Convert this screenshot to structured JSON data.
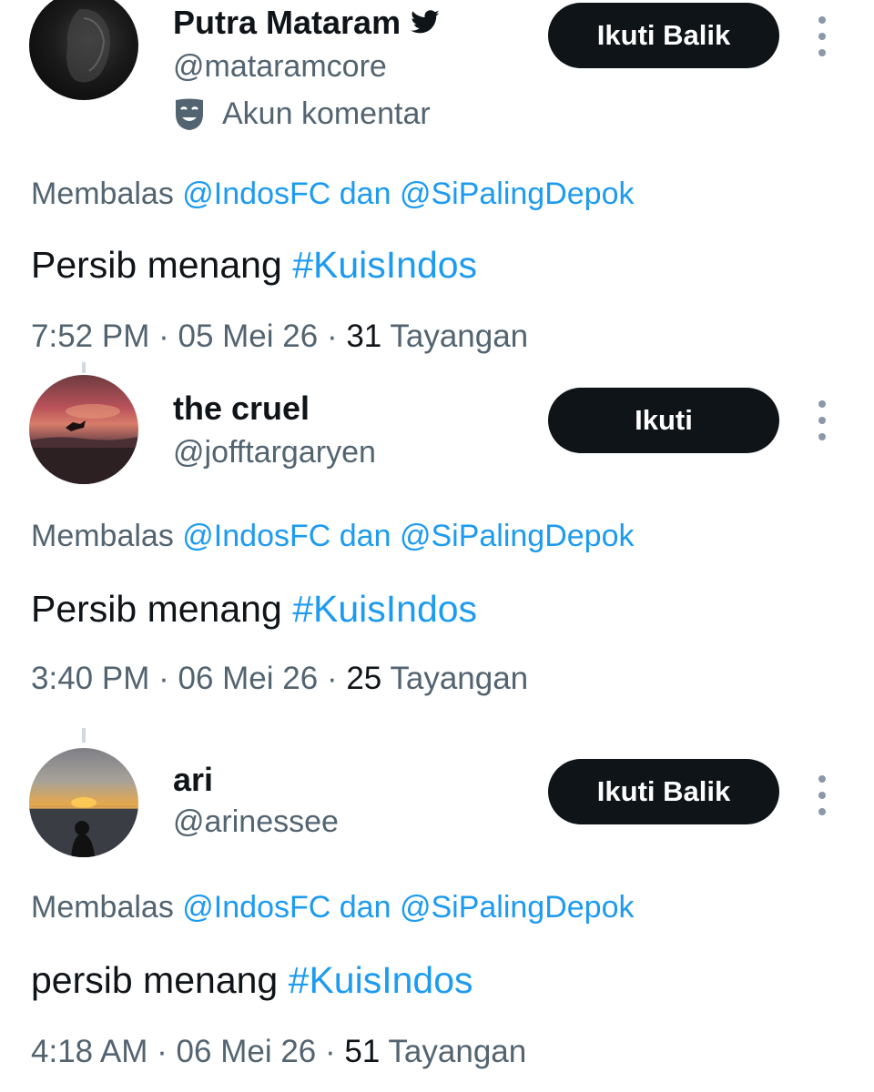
{
  "tweets": [
    {
      "name": "Putra Mataram",
      "handle": "@mataramcore",
      "label": "Akun komentar",
      "follow": "Ikuti Balik",
      "replying_prefix": "Membalas",
      "mention1": "@IndosFC",
      "replying_mid": "dan",
      "mention2": "@SiPalingDepok",
      "text": "Persib menang",
      "hashtag": "#KuisIndos",
      "time": "7:52 PM",
      "date": "05 Mei 26",
      "views": "31",
      "views_label": "Tayangan"
    },
    {
      "name": "the cruel",
      "handle": "@jofftargaryen",
      "follow": "Ikuti",
      "replying_prefix": "Membalas",
      "mention1": "@IndosFC",
      "replying_mid": "dan",
      "mention2": "@SiPalingDepok",
      "text": "Persib menang",
      "hashtag": "#KuisIndos",
      "time": "3:40 PM",
      "date": "06 Mei 26",
      "views": "25",
      "views_label": "Tayangan"
    },
    {
      "name": "ari",
      "handle": "@arinessee",
      "follow": "Ikuti Balik",
      "replying_prefix": "Membalas",
      "mention1": "@IndosFC",
      "replying_mid": "dan",
      "mention2": "@SiPalingDepok",
      "text": "persib menang",
      "hashtag": "#KuisIndos",
      "time": "4:18 AM",
      "date": "06 Mei 26",
      "views": "51",
      "views_label": "Tayangan"
    }
  ],
  "separator": "·",
  "colors": {
    "accent": "#1d9bf0",
    "text": "#0f1419",
    "muted": "#536471",
    "button": "#0f1419"
  },
  "icons": {
    "verified": "bird-icon",
    "label": "theater-mask-icon",
    "more": "more-vertical-icon"
  }
}
